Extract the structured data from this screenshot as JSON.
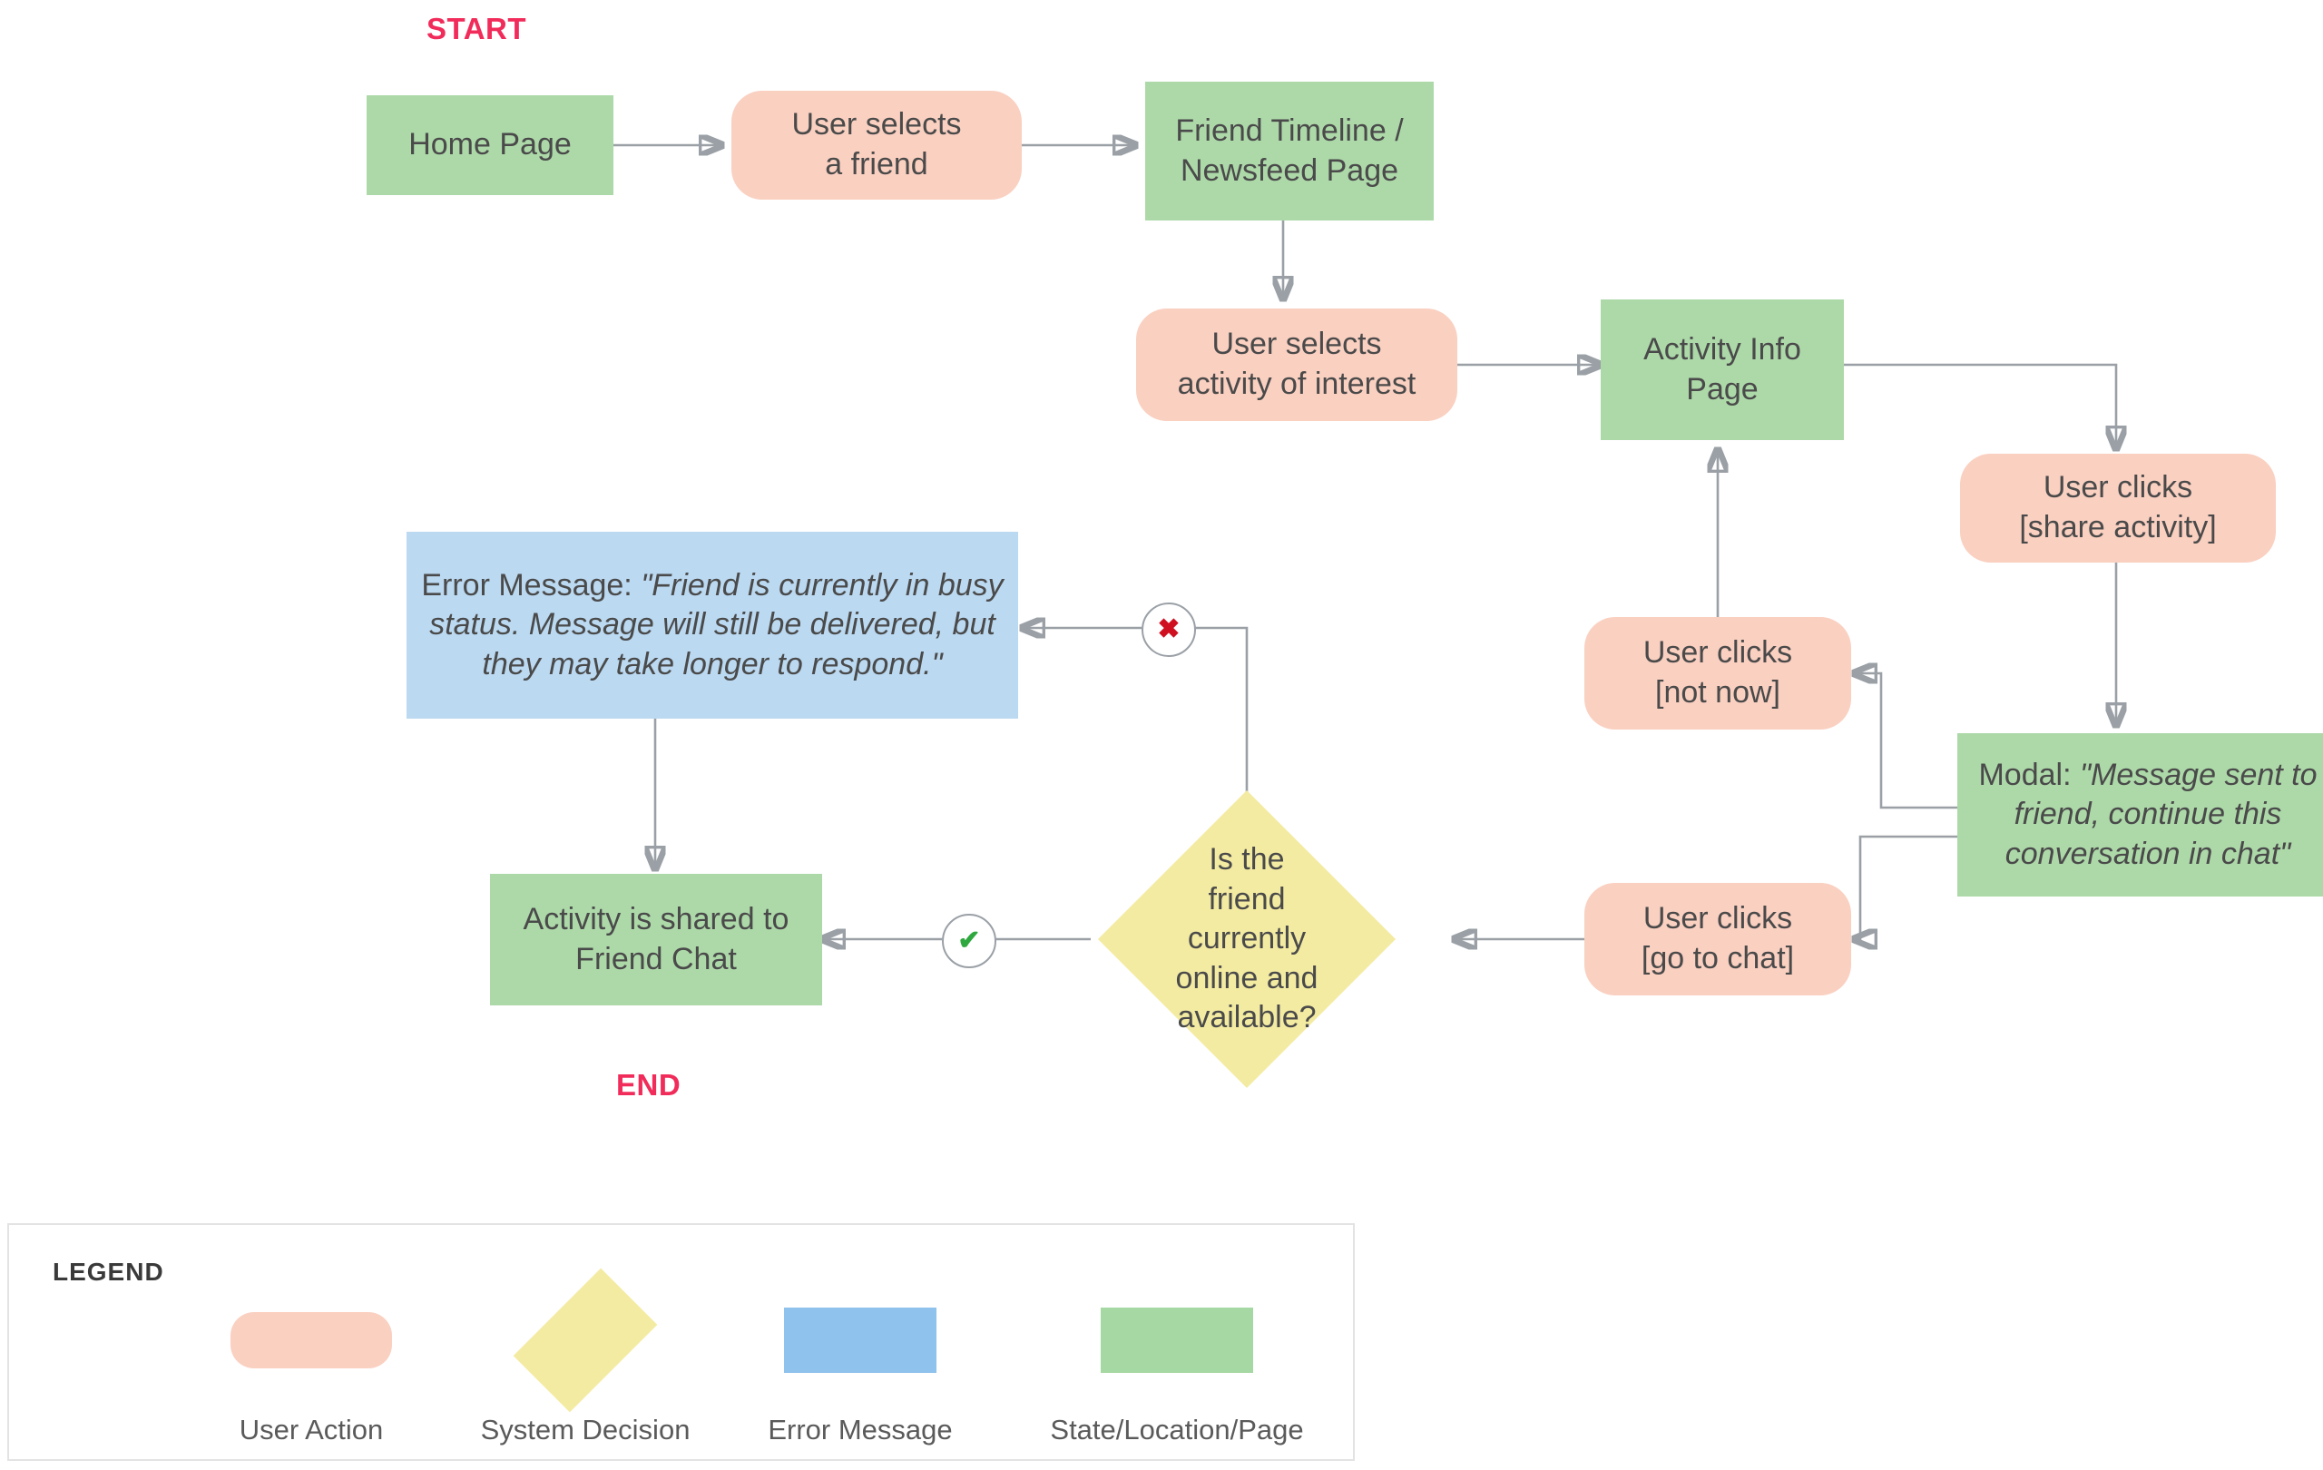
{
  "meta": {
    "diagram_type": "flowchart",
    "start_label": "START",
    "end_label": "END"
  },
  "nodes": {
    "home_page": "Home Page",
    "select_friend": "User selects\na friend",
    "friend_timeline": "Friend Timeline /\nNewsfeed Page",
    "select_activity": "User selects\nactivity of interest",
    "activity_info": "Activity Info\nPage",
    "share_activity": "User clicks\n[share activity]",
    "modal_prefix": "Modal: ",
    "modal_quote": "\"Message sent to friend, continue this conversation in chat\"",
    "not_now": "User clicks\n[not now]",
    "go_to_chat": "User clicks\n[go to chat]",
    "decision": "Is the friend currently online and available?",
    "error_prefix": "Error Message: ",
    "error_quote": "\"Friend is currently in busy status. Message will still be delivered, but they may take longer to respond.\"",
    "shared_to_chat": "Activity is shared to\nFriend Chat"
  },
  "markers": {
    "no": "✖",
    "yes": "✔"
  },
  "legend": {
    "title": "LEGEND",
    "items": [
      {
        "label": "User Action",
        "shape": "rounded-rect",
        "color": "#FAD0C1"
      },
      {
        "label": "System Decision",
        "shape": "diamond",
        "color": "#F4EBA2"
      },
      {
        "label": "Error Message",
        "shape": "rect",
        "color": "#8FC2EC"
      },
      {
        "label": "State/Location/Page",
        "shape": "rect",
        "color": "#A6D8A3"
      }
    ]
  },
  "colors": {
    "state": "#ADD9A9",
    "action": "#FAD0C1",
    "error": "#BBD9F1",
    "decision": "#F4EBA2",
    "accent": "#F12B5A",
    "connector": "#9AA0A6",
    "text": "#4A4A4A",
    "marker_no": "#CF1020",
    "marker_yes": "#2FA83F"
  }
}
